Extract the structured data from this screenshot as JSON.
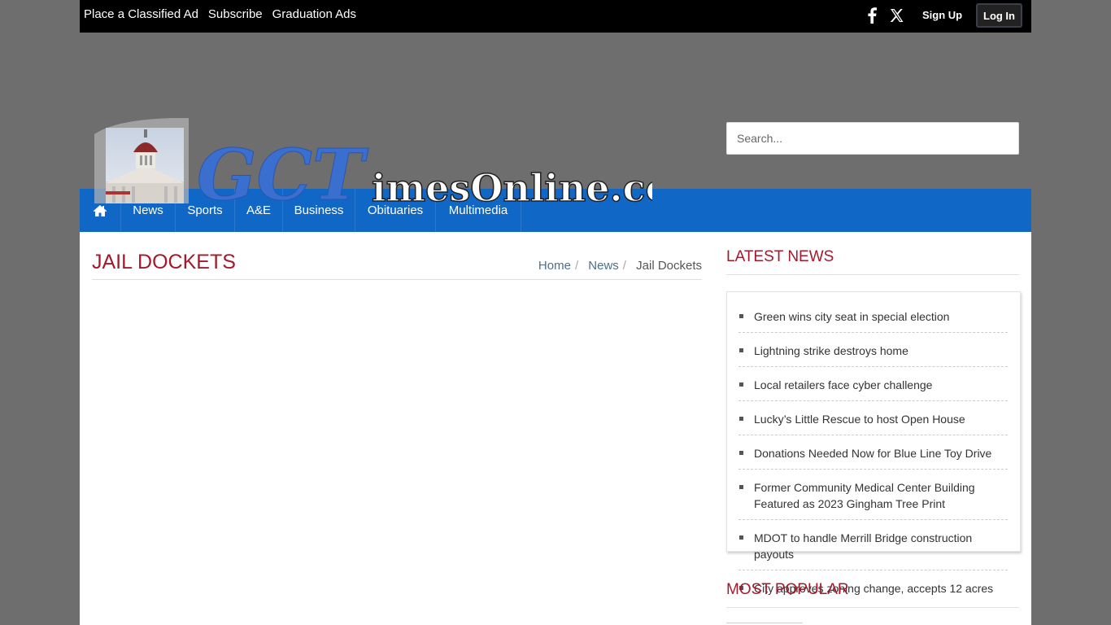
{
  "topbar": {
    "links": [
      "Place a Classified Ad",
      "Subscribe",
      "Graduation Ads"
    ],
    "signup": "Sign Up",
    "login": "Log In"
  },
  "logo": {
    "text": "GCTimesOnline.com"
  },
  "search": {
    "placeholder": "Search..."
  },
  "nav": {
    "items": [
      "News",
      "Sports",
      "A&E",
      "Business",
      "Obituaries",
      "Multimedia"
    ]
  },
  "page": {
    "title": "JAIL DOCKETS",
    "breadcrumb": [
      "Home",
      "News",
      "Jail Dockets"
    ]
  },
  "sidebar": {
    "latest_title": "LATEST NEWS",
    "latest_items": [
      "Green wins city seat in special election",
      "Lightning strike destroys home",
      "Local retailers face cyber challenge",
      "Lucky’s Little Rescue to host Open House",
      "Donations Needed Now for Blue Line Toy Drive",
      "Former Community Medical Center Building Featured as 2023 Gingham Tree Print",
      "MDOT to handle Merrill Bridge construction payouts",
      "City approves zoning change, accepts 12 acres"
    ],
    "popular_title": "MOST POPULAR"
  },
  "colors": {
    "topbar": "#000000",
    "nav": "#1167c5",
    "accent": "#a41a2c",
    "header_bg": "#6e6e6e"
  }
}
